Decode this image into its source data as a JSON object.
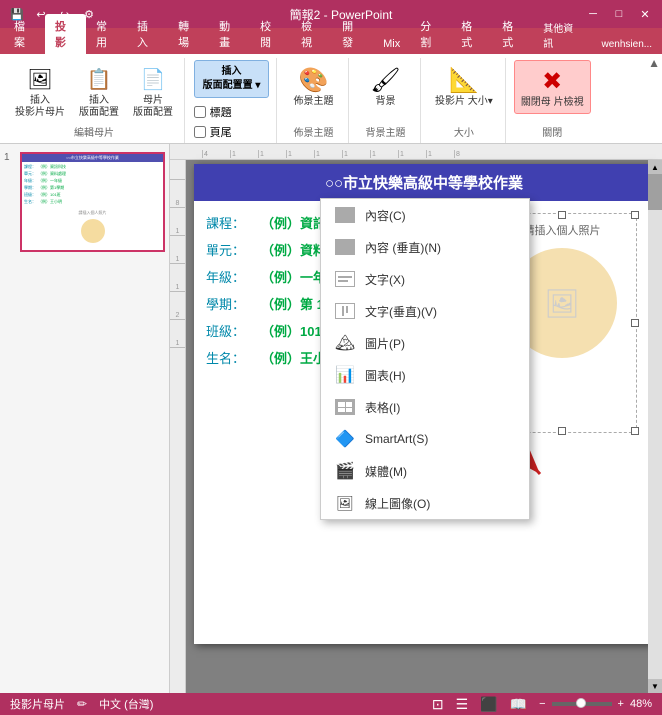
{
  "titleBar": {
    "title": "簡報2 - PowerPoint",
    "saveIcon": "💾",
    "undoIcon": "↩",
    "redoIcon": "↪",
    "customizeIcon": "⚙",
    "minBtn": "─",
    "maxBtn": "□",
    "closeBtn": "✕"
  },
  "ribbonTabs": [
    "檔案",
    "投影",
    "常用",
    "插入",
    "轉場",
    "動畫",
    "校閱",
    "檢視",
    "開發",
    "Mix",
    "分割",
    "格式",
    "格式",
    "其他資訊",
    "wenhsien..."
  ],
  "activeTab": "投影",
  "ribbonGroups": {
    "insertSlide": {
      "label": "編輯母片",
      "buttons": [
        {
          "id": "insert-slide-master",
          "label": "插入\n投影片母片"
        },
        {
          "id": "insert-layout",
          "label": "插入\n版面配置"
        },
        {
          "id": "slide-master",
          "label": "母片\n版面配置"
        }
      ]
    },
    "insertPlaceholder": {
      "label": "版面配置▾",
      "mainBtn": "插入\n版面配置置▾"
    }
  },
  "checkboxes": {
    "titleLabel": "標題",
    "footerLabel": "頁尾",
    "titleChecked": false,
    "footerChecked": false
  },
  "themeBtn": "佈景主題",
  "backgroundBtn": "背景主題",
  "slideSizeLabel": "投影片\n大小▾",
  "closeViewLabel": "關閉母\n片檢視",
  "dropdownMenu": {
    "items": [
      {
        "id": "content",
        "label": "內容(C)",
        "icon": "grid"
      },
      {
        "id": "content-v",
        "label": "內容 (垂直)(N)",
        "icon": "grid-v"
      },
      {
        "id": "text",
        "label": "文字(X)",
        "icon": "text"
      },
      {
        "id": "text-v",
        "label": "文字(垂直)(V)",
        "icon": "text-v"
      },
      {
        "id": "picture",
        "label": "圖片(P)",
        "icon": "photo"
      },
      {
        "id": "chart",
        "label": "圖表(H)",
        "icon": "chart"
      },
      {
        "id": "table",
        "label": "表格(I)",
        "icon": "table"
      },
      {
        "id": "smartart",
        "label": "SmartArt(S)",
        "icon": "smartart"
      },
      {
        "id": "media",
        "label": "媒體(M)",
        "icon": "media"
      },
      {
        "id": "online",
        "label": "線上圖像(O)",
        "icon": "online"
      }
    ]
  },
  "slideContent": {
    "headerText": "○○市立快樂高級中等學校作業",
    "rows": [
      {
        "label": "課程：",
        "value": "（例）資訊科技"
      },
      {
        "label": "單元：",
        "value": "（例）資料處理"
      },
      {
        "label": "年級：",
        "value": "（例）一年級"
      },
      {
        "label": "學期：",
        "value": "（例）第 1 學期"
      },
      {
        "label": "班級：",
        "value": "（例）101班"
      },
      {
        "label": "生名：",
        "value": "（例）王小明"
      }
    ],
    "photoPlaceholder": "請插入個人照片"
  },
  "statusBar": {
    "mode": "投影片母片",
    "language": "中文 (台灣)",
    "viewIcons": [
      "normal",
      "outline",
      "slideshow",
      "reading"
    ],
    "zoom": "48%",
    "zoomValue": 48
  }
}
